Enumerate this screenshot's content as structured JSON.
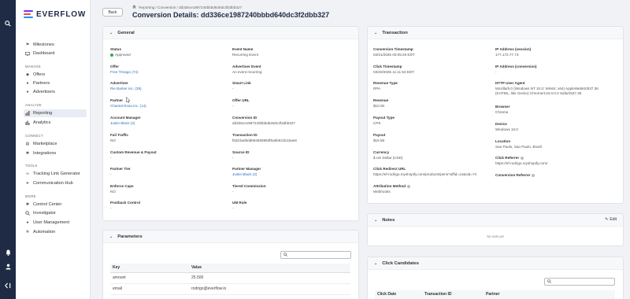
{
  "sidebar": {
    "logo_text": "EVERFLOW",
    "brand_colors": [
      "#7b2ff7",
      "#e94f37",
      "#1e90ff"
    ],
    "sections": {
      "top": [
        {
          "label": "Milestones",
          "icon": "flag-icon"
        },
        {
          "label": "Dashboard",
          "icon": "monitor-icon"
        }
      ],
      "manage_label": "MANAGE",
      "manage": [
        {
          "label": "Offers",
          "icon": "tag-icon"
        },
        {
          "label": "Partners",
          "icon": "users-icon"
        },
        {
          "label": "Advertisers",
          "icon": "users-icon"
        }
      ],
      "analyze_label": "ANALYZE",
      "analyze": [
        {
          "label": "Reporting",
          "icon": "chart-icon"
        },
        {
          "label": "Analytics",
          "icon": "analytics-icon"
        }
      ],
      "connect_label": "CONNECT",
      "connect": [
        {
          "label": "Marketplace",
          "icon": "store-icon"
        },
        {
          "label": "Integrations",
          "icon": "gear-icon"
        }
      ],
      "tools_label": "TOOLS",
      "tools": [
        {
          "label": "Tracking Link Generator",
          "icon": "link-icon"
        },
        {
          "label": "Communication Hub",
          "icon": "send-icon"
        }
      ],
      "more_label": "MORE",
      "more": [
        {
          "label": "Control Center",
          "icon": "gear-icon"
        },
        {
          "label": "Investigator",
          "icon": "search-icon"
        },
        {
          "label": "User Management",
          "icon": "user-gear-icon"
        },
        {
          "label": "Automation",
          "icon": "cogs-icon"
        }
      ]
    }
  },
  "header": {
    "back_label": "Back",
    "breadcrumb": "Reporting  /  Conversion  /  dd336ce1987240bbbd640dc3f2dbb327",
    "title": "Conversion Details: dd336ce1987240bbbd640dc3f2dbb327"
  },
  "general": {
    "title": "General",
    "fields": {
      "status": {
        "label": "Status",
        "value": "Approved"
      },
      "event_name": {
        "label": "Event Name",
        "value": "Recurring Event"
      },
      "offer": {
        "label": "Offer",
        "value": "Free Trinago (74)"
      },
      "advertiser_event": {
        "label": "Advertiser Event",
        "value": "An event recurring"
      },
      "advertiser": {
        "label": "Advertiser",
        "value": "Rie Barker inc. (39)"
      },
      "smart_link": {
        "label": "Smart Link",
        "value": "-"
      },
      "partner": {
        "label": "Partner",
        "value": "Chantal Rosa inc. (14)"
      },
      "offer_url": {
        "label": "Offer URL",
        "value": "-"
      },
      "account_manager": {
        "label": "Account Manager",
        "value": "Justin Black (2)"
      },
      "conversion_id": {
        "label": "Conversion ID",
        "value": "dd336ce1987240bbbd640dc3f2dbb327"
      },
      "fail_traffic": {
        "label": "Fail Traffic",
        "value": "NO"
      },
      "transaction_id": {
        "label": "Transaction ID",
        "value": "f6d23ad9dd694568993f5a5b921b15ae8"
      },
      "custom_revenue": {
        "label": "Custom Revenue & Payout",
        "value": "-"
      },
      "source_id": {
        "label": "Source ID",
        "value": "-"
      },
      "partner_tier": {
        "label": "Partner Tier",
        "value": "-"
      },
      "partner_manager": {
        "label": "Partner Manager",
        "value": "Justin Black (2)"
      },
      "enforce_caps": {
        "label": "Enforce Caps",
        "value": "NO"
      },
      "tiered_commission": {
        "label": "Tiered Commission",
        "value": "-"
      },
      "postback_control": {
        "label": "Postback Control",
        "value": "-"
      },
      "um_rule": {
        "label": "UM Rule",
        "value": "-"
      }
    }
  },
  "transaction": {
    "title": "Transaction",
    "fields": {
      "conversion_timestamp": {
        "label": "Conversion Timestamp",
        "value": "03/21/2025 00:05:26 EDT"
      },
      "ip_session": {
        "label": "IP Address (session)",
        "value": "177.172.77.73"
      },
      "click_timestamp": {
        "label": "Click Timestamp",
        "value": "03/20/2025 11:11:53 EDT"
      },
      "ip_conversion": {
        "label": "IP Address (conversion)",
        "value": "-"
      },
      "revenue_type": {
        "label": "Revenue Type",
        "value": "RPA"
      },
      "http_user_agent": {
        "label": "HTTP User Agent",
        "value": "Mozilla/5.0 (Windows NT 10.0; Win64; x64) AppleWebKit/537.36 (KHTML, like Gecko) Chrome/134.0.0.0 Safari/537.36"
      },
      "revenue": {
        "label": "Revenue",
        "value": "$10.00"
      },
      "browser": {
        "label": "Browser",
        "value": "Chrome"
      },
      "payout_type": {
        "label": "Payout Type",
        "value": "CPS"
      },
      "device": {
        "label": "Device",
        "value": "Windows 10.0"
      },
      "payout": {
        "label": "Payout",
        "value": "$16.58"
      },
      "location": {
        "label": "Location",
        "value": "Sao Paulo, Sao Paulo, Brazil"
      },
      "currency": {
        "label": "Currency",
        "value": "$ US Dollar (USD)"
      },
      "click_referrer": {
        "label": "Click Referrer",
        "value": "https://ef-rodrigo.myshopify.com/"
      },
      "click_redirect_url": {
        "label": "Click Redirect URL",
        "value": "https://ef-rodrigo.myshopify.com/products/pens?affid=14&oid=74"
      },
      "conversion_referrer": {
        "label": "Conversion Referrer",
        "value": ""
      },
      "attribution_method": {
        "label": "Attribution Method",
        "value": "Webhooks"
      }
    }
  },
  "parameters": {
    "title": "Parameters",
    "columns": [
      "Key",
      "Value"
    ],
    "rows": [
      [
        "amount",
        "25.500"
      ],
      [
        "email",
        "rodrigo@everflow.io"
      ]
    ]
  },
  "notes": {
    "title": "Notes",
    "edit_label": "Edit",
    "empty_text": "No note yet"
  },
  "click_candidates": {
    "title": "Click Candidates",
    "columns": [
      "Click Date",
      "Transaction ID",
      "Partner"
    ]
  }
}
